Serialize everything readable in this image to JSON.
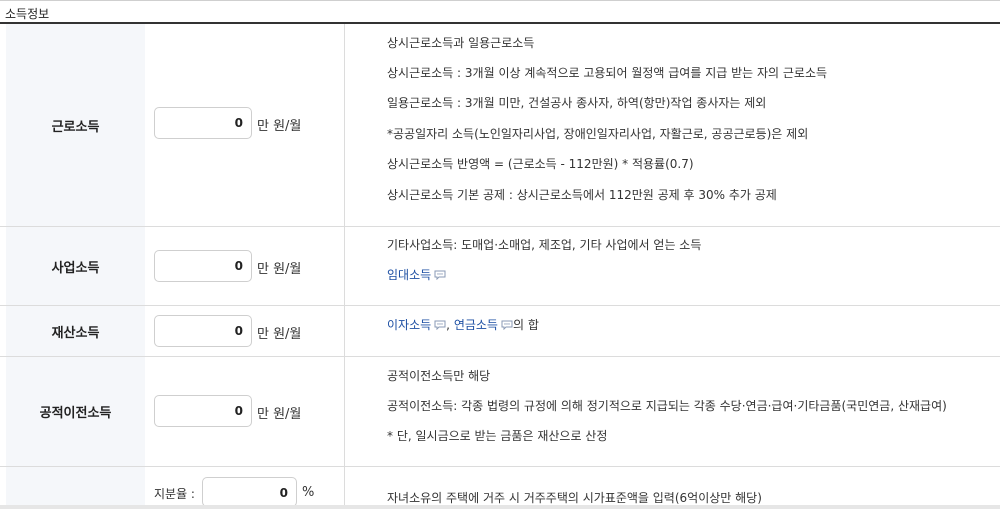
{
  "section": {
    "title": "소득정보"
  },
  "rows": {
    "earned": {
      "label": "근로소득",
      "value": "0",
      "unit": "만 원/월",
      "desc": [
        "상시근로소득과 일용근로소득",
        "상시근로소득 : 3개월 이상 계속적으로 고용되어 월정액 급여를 지급 받는 자의 근로소득",
        "일용근로소득 : 3개월 미만, 건설공사 종사자, 하역(항만)작업 종사자는 제외",
        "*공공일자리 소득(노인일자리사업, 장애인일자리사업, 자활근로, 공공근로등)은 제외",
        "상시근로소득 반영액 = (근로소득 - 112만원) * 적용률(0.7)",
        "상시근로소득 기본 공제 : 상시근로소득에서 112만원 공제 후 30% 추가 공제"
      ]
    },
    "business": {
      "label": "사업소득",
      "value": "0",
      "unit": "만 원/월",
      "desc": "기타사업소득: 도매업·소매업, 제조업, 기타 사업에서 얻는 소득",
      "link": "임대소득"
    },
    "property": {
      "label": "재산소득",
      "value": "0",
      "unit": "만 원/월",
      "link_interest": "이자소득",
      "separator": ", ",
      "link_pension": "연금소득",
      "suffix": "의 합"
    },
    "transfer": {
      "label": "공적이전소득",
      "value": "0",
      "unit": "만 원/월",
      "desc": [
        "공적이전소득만 해당",
        "공적이전소득: 각종 법령의 규정에 의해 정기적으로 지급되는 각종 수당·연금·급여·기타금품(국민연금, 산재급여)",
        "* 단, 일시금으로 받는 금품은 재산으로 산정"
      ]
    },
    "housing": {
      "share_label": "지분율 :",
      "share_value": "0",
      "share_unit": "%",
      "desc": "자녀소유의 주택에 거주 시 거주주택의 시가표준액을 입력(6억이상만 해당)"
    }
  },
  "colors": {
    "link": "#1d4fa3",
    "header_bg": "#f5f7fa"
  },
  "icons": {
    "help": "speech-bubble-help-icon"
  }
}
